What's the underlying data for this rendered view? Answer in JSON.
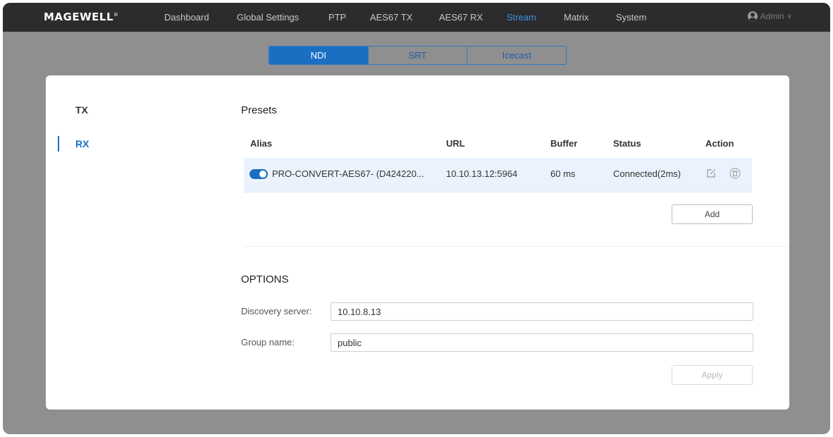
{
  "brand": {
    "name": "MAGEWELL",
    "mark": "®"
  },
  "nav": [
    {
      "label": "Dashboard"
    },
    {
      "label": "Global Settings"
    },
    {
      "label": "PTP"
    },
    {
      "label": "AES67 TX"
    },
    {
      "label": "AES67 RX"
    },
    {
      "label": "Stream",
      "active": true
    },
    {
      "label": "Matrix"
    },
    {
      "label": "System"
    }
  ],
  "user": {
    "label": "Admin",
    "icon": "user-avatar-icon",
    "chevron": "∨"
  },
  "subtabs": [
    {
      "label": "NDI",
      "active": true
    },
    {
      "label": "SRT"
    },
    {
      "label": "Icecast"
    }
  ],
  "sidebar": [
    {
      "label": "TX"
    },
    {
      "label": "RX",
      "active": true
    }
  ],
  "presets": {
    "title": "Presets",
    "columns": [
      "Alias",
      "URL",
      "Buffer",
      "Status",
      "Action"
    ],
    "rows": [
      {
        "enabled": true,
        "alias": "PRO-CONVERT-AES67- (D424220...",
        "url": "10.10.13.12:5964",
        "buffer": "60 ms",
        "status": "Connected(2ms)",
        "actions": [
          "edit-icon",
          "delete-icon"
        ]
      }
    ],
    "add_label": "Add"
  },
  "options": {
    "title": "OPTIONS",
    "discovery_label": "Discovery server:",
    "discovery_value": "10.10.8.13",
    "group_label": "Group name:",
    "group_value": "public",
    "apply_label": "Apply"
  },
  "colors": {
    "accent": "#1b6fc2",
    "topbar": "#2c2c2e",
    "backdrop": "#8f8f8f",
    "row_highlight": "#eaf3fd"
  }
}
